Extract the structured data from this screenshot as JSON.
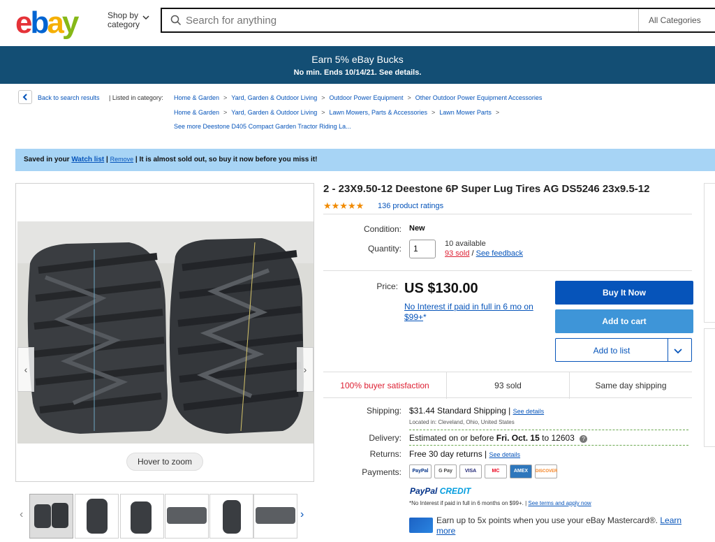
{
  "header": {
    "logo_letters": [
      "e",
      "b",
      "a",
      "y"
    ],
    "shop_by_line1": "Shop by",
    "shop_by_line2": "category",
    "search_placeholder": "Search for anything",
    "category_select": "All Categories"
  },
  "promo": {
    "title": "Earn 5% eBay Bucks",
    "subtitle": "No min. Ends 10/14/21. See details."
  },
  "breadcrumbs": {
    "back_label": "Back to search results",
    "listed_in": "| Listed in category:",
    "row1": [
      "Home & Garden",
      "Yard, Garden & Outdoor Living",
      "Outdoor Power Equipment",
      "Other Outdoor Power Equipment Accessories"
    ],
    "row2": [
      "Home & Garden",
      "Yard, Garden & Outdoor Living",
      "Lawn Mowers, Parts & Accessories",
      "Lawn Mower Parts"
    ],
    "see_more": "See more Deestone D405 Compact Garden Tractor Riding La..."
  },
  "watchbar": {
    "saved_prefix": "Saved in your",
    "watch_list": "Watch list",
    "remove": "Remove",
    "message": "| It is almost sold out, so buy it now before you miss it!"
  },
  "gallery": {
    "zoom_label": "Hover to zoom",
    "thumb_count": 6
  },
  "product": {
    "title": "2 - 23X9.50-12 Deestone 6P Super Lug Tires AG DS5246 23x9.5-12",
    "stars": "★★★★★",
    "rating_count": "136 product ratings",
    "condition_label": "Condition:",
    "condition_value": "New",
    "quantity_label": "Quantity:",
    "quantity_value": "1",
    "available": "10 available",
    "sold": "93 sold",
    "feedback": "See feedback",
    "price_label": "Price:",
    "price": "US $130.00",
    "finance_offer": "No Interest if paid in full in 6 mo on $99+",
    "finance_suffix": "*"
  },
  "actions": {
    "buy_now": "Buy It Now",
    "add_to_cart": "Add to cart",
    "add_to_list": "Add to list"
  },
  "stats": {
    "satisfaction": "100% buyer satisfaction",
    "sold": "93 sold",
    "shipping": "Same day shipping"
  },
  "shipping": {
    "label": "Shipping:",
    "price": "$31.44",
    "method": "Standard Shipping |",
    "details_link": "See details",
    "location": "Located in:  Cleveland, Ohio, United States"
  },
  "delivery": {
    "label": "Delivery:",
    "text_prefix": "Estimated on or before",
    "date": "Fri. Oct. 15",
    "text_suffix": "to 12603"
  },
  "returns": {
    "label": "Returns:",
    "text": "Free 30 day returns |",
    "details_link": "See details"
  },
  "payments": {
    "label": "Payments:",
    "methods": [
      "PayPal",
      "G Pay",
      "VISA",
      "MC",
      "AMEX",
      "DISCOVER"
    ],
    "paypal_credit_a": "PayPal",
    "paypal_credit_b": "CREDIT",
    "finance_note": "*No Interest if paid in full in 6 months on $99+.",
    "terms_link": "See terms and apply now",
    "mastercard_text": "Earn up to 5x points when you use your eBay Mastercard®.",
    "learn_more": "Learn more"
  },
  "colors": {
    "promo_bg": "#134e74",
    "watchbar_bg": "#a7d4f5",
    "buy_now": "#0654ba",
    "add_to_cart": "#3e95d8",
    "link": "#0654ba",
    "sold_red": "#dd1e31",
    "star": "#f18a00"
  }
}
